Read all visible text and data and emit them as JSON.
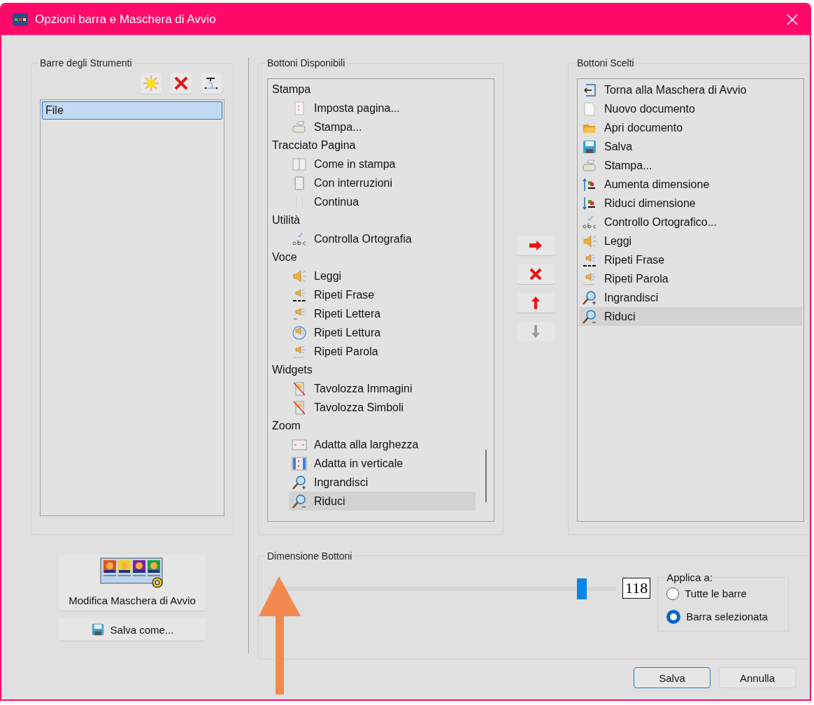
{
  "window": {
    "title": "Opzioni barra e Maschera di Avvio"
  },
  "toolbars": {
    "title": "Barre degli Strumenti",
    "items": [
      {
        "label": "File",
        "selected": true
      }
    ]
  },
  "available": {
    "title": "Bottoni Disponibili",
    "groups": [
      {
        "label": "Stampa",
        "children": [
          {
            "label": "Imposta pagina...",
            "kind": "page-setup",
            "selected": false
          },
          {
            "label": "Stampa...",
            "kind": "printer",
            "selected": false
          }
        ]
      },
      {
        "label": "Tracciato Pagina",
        "children": [
          {
            "label": "Come in stampa",
            "kind": "two-page",
            "selected": false
          },
          {
            "label": "Con interruzioni",
            "kind": "page",
            "selected": false
          },
          {
            "label": "Continua",
            "kind": "continuous",
            "selected": false
          }
        ]
      },
      {
        "label": "Utilità",
        "children": [
          {
            "label": "Controlla Ortografia",
            "kind": "spellcheck",
            "selected": false
          }
        ]
      },
      {
        "label": "Voce",
        "children": [
          {
            "label": "Leggi",
            "kind": "speaker",
            "selected": false
          },
          {
            "label": "Ripeti Frase",
            "kind": "speaker-line",
            "selected": false
          },
          {
            "label": "Ripeti Lettera",
            "kind": "speaker-letter",
            "selected": false
          },
          {
            "label": "Ripeti Lettura",
            "kind": "speaker-repeat",
            "selected": false
          },
          {
            "label": "Ripeti Parola",
            "kind": "speaker-word",
            "selected": false
          }
        ]
      },
      {
        "label": "Widgets",
        "children": [
          {
            "label": "Tavolozza Immagini",
            "kind": "palette-off",
            "selected": false
          },
          {
            "label": "Tavolozza Simboli",
            "kind": "palette-off",
            "selected": false
          }
        ]
      },
      {
        "label": "Zoom",
        "children": [
          {
            "label": "Adatta alla larghezza",
            "kind": "fit-width",
            "selected": false
          },
          {
            "label": "Adatta in verticale",
            "kind": "fit-height",
            "selected": false
          },
          {
            "label": "Ingrandisci",
            "kind": "zoom-in",
            "selected": false
          },
          {
            "label": "Riduci",
            "kind": "zoom-out",
            "selected": true
          }
        ]
      }
    ]
  },
  "chosen": {
    "title": "Bottoni Scelti",
    "items": [
      {
        "label": "Torna alla Maschera di Avvio",
        "kind": "back-arrow",
        "selected": false
      },
      {
        "label": "Nuovo documento",
        "kind": "document",
        "selected": false
      },
      {
        "label": "Apri documento",
        "kind": "folder",
        "selected": false
      },
      {
        "label": "Salva",
        "kind": "floppy",
        "selected": false
      },
      {
        "label": "Stampa...",
        "kind": "printer",
        "selected": false
      },
      {
        "label": "Aumenta dimensione",
        "kind": "size-up",
        "selected": false
      },
      {
        "label": "Riduci dimensione",
        "kind": "size-down",
        "selected": false
      },
      {
        "label": "Controllo Ortografico...",
        "kind": "spellcheck",
        "selected": false
      },
      {
        "label": "Leggi",
        "kind": "speaker",
        "selected": false
      },
      {
        "label": "Ripeti Frase",
        "kind": "speaker-line",
        "selected": false
      },
      {
        "label": "Ripeti Parola",
        "kind": "speaker-word",
        "selected": false
      },
      {
        "label": "Ingrandisci",
        "kind": "zoom-in",
        "selected": false
      },
      {
        "label": "Riduci",
        "kind": "zoom-out",
        "selected": true
      }
    ]
  },
  "move_buttons": [
    {
      "kind": "add",
      "disabled": false
    },
    {
      "kind": "remove",
      "disabled": false
    },
    {
      "kind": "up",
      "disabled": false
    },
    {
      "kind": "down",
      "disabled": true
    }
  ],
  "edit_mask_button": "Modifica Maschera di Avvio",
  "save_as_button": "Salva come...",
  "button_size": {
    "title": "Dimensione Bottoni",
    "level": 0.9,
    "value": "118",
    "apply_to": {
      "title": "Applica a:",
      "options": [
        {
          "label": "Tutte le barre",
          "selected": false
        },
        {
          "label": "Barra selezionata",
          "selected": true
        }
      ]
    }
  },
  "footer_buttons": [
    {
      "label": "Salva",
      "kind": "primary"
    },
    {
      "label": "Annulla",
      "kind": "secondary"
    }
  ]
}
